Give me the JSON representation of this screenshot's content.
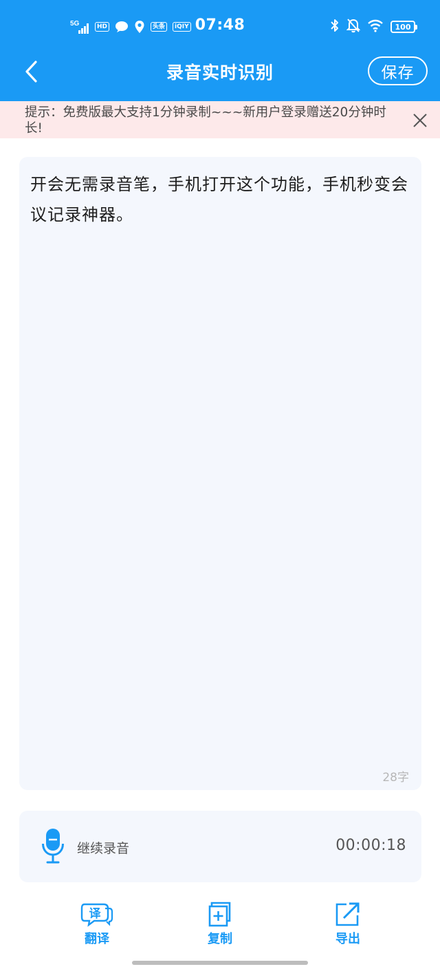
{
  "status_bar": {
    "network": "5G",
    "hd_badge": "HD",
    "app_badge_1": "头条",
    "app_badge_2": "iQIY",
    "time": "07:48",
    "battery": "100",
    "icons": [
      "signal-icon",
      "message-icon",
      "location-icon",
      "bluetooth-icon",
      "mute-bell-icon",
      "wifi-icon"
    ]
  },
  "navbar": {
    "back_icon": "chevron-left-icon",
    "title": "录音实时识别",
    "save_label": "保存"
  },
  "notice": {
    "text": "提示：免费版最大支持1分钟录制~~~新用户登录赠送20分钟时长!",
    "close_icon": "close-icon"
  },
  "content": {
    "text": "开会无需录音笔，手机打开这个功能，手机秒变会议记录神器。",
    "char_count": "28字"
  },
  "recorder": {
    "icon": "microphone-icon",
    "label": "继续录音",
    "elapsed": "00:00:18"
  },
  "toolbar": {
    "items": [
      {
        "label": "翻译",
        "icon": "translate-icon",
        "icon_glyph": "译"
      },
      {
        "label": "复制",
        "icon": "copy-icon"
      },
      {
        "label": "导出",
        "icon": "export-icon"
      }
    ]
  },
  "colors": {
    "primary": "#1a9af5",
    "notice_bg": "#fde9ea",
    "card_bg": "#f4f7fd"
  }
}
